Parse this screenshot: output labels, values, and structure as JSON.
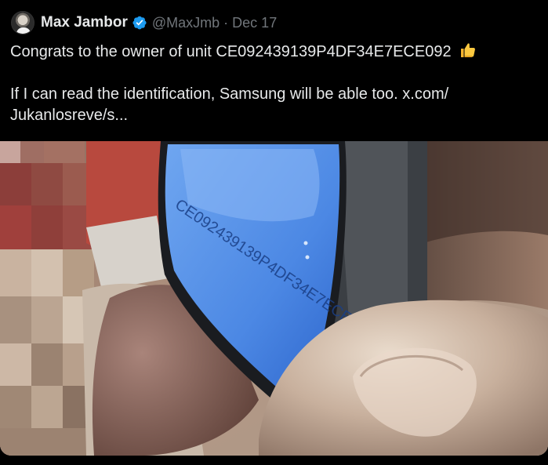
{
  "author": {
    "display_name": "Max Jambor",
    "handle": "@MaxJmb",
    "separator": "·",
    "date": "Dec 17",
    "verified": true,
    "verified_color": "#1d9bf0"
  },
  "tweet": {
    "line1": "Congrats to the owner of unit CE092439139P4DF34E7ECE092",
    "line1_emoji": "thumbs-up-icon",
    "line2": "If I can read the identification, Samsung will be able too.  x.com/",
    "line3": "Jukanlosreve/s..."
  },
  "colors": {
    "background": "#000000",
    "text": "#e7e9ea",
    "secondary_text": "#71767b"
  }
}
